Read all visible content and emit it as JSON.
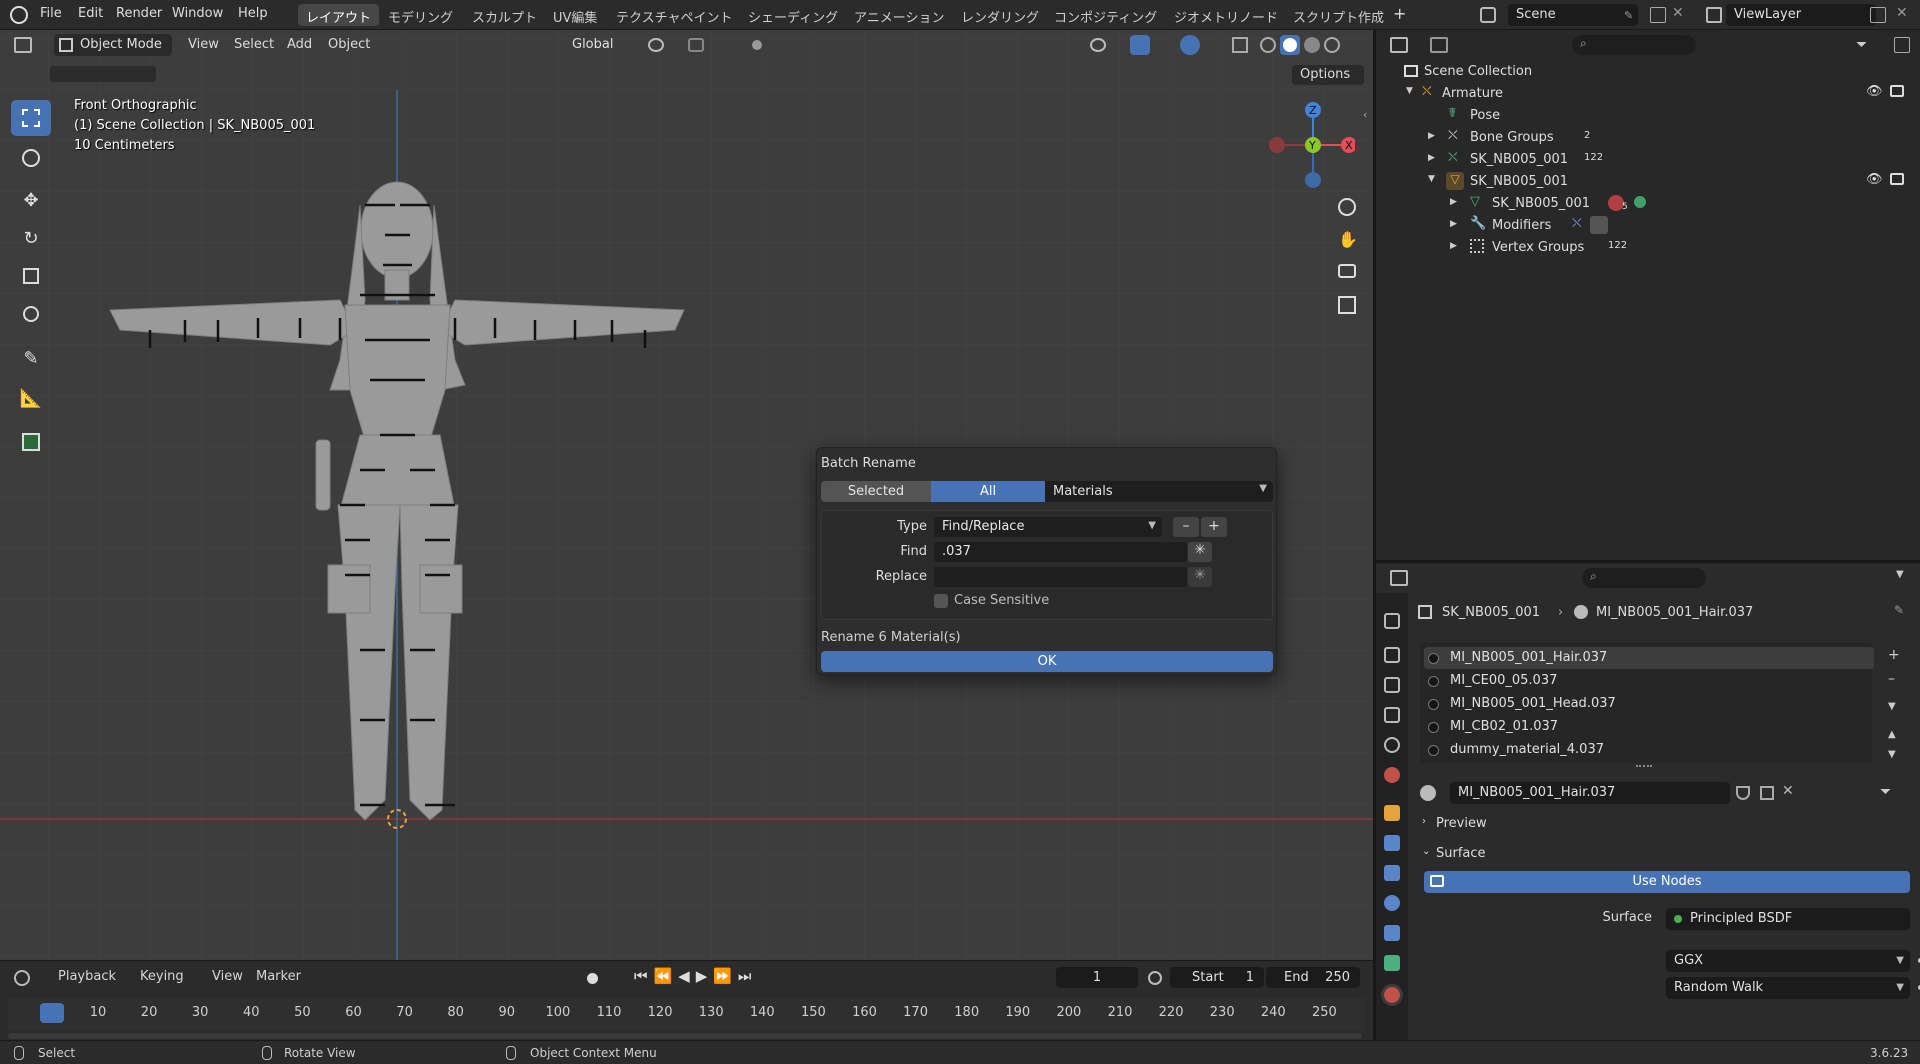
{
  "topbar": {
    "menus": [
      "File",
      "Edit",
      "Render",
      "Window",
      "Help"
    ],
    "workspaces": [
      "レイアウト",
      "モデリング",
      "スカルプト",
      "UV編集",
      "テクスチャペイント",
      "シェーディング",
      "アニメーション",
      "レンダリング",
      "コンポジティング",
      "ジオメトリノード",
      "スクリプト作成"
    ],
    "add_tab": "+",
    "scene": "Scene",
    "view_layer": "ViewLayer"
  },
  "viewport": {
    "mode": "Object Mode",
    "menus": [
      "View",
      "Select",
      "Add",
      "Object"
    ],
    "orientation": "Global",
    "options": "Options",
    "view_name": "Front Orthographic",
    "collection_info": "(1) Scene Collection | SK_NB005_001",
    "scale_info": "10 Centimeters",
    "gizmo": {
      "z": "Z",
      "y": "Y",
      "x": "X"
    }
  },
  "dialog": {
    "title": "Batch Rename",
    "tab_selected": "Selected",
    "tab_all": "All",
    "data_type": "Materials",
    "type_label": "Type",
    "type_value": "Find/Replace",
    "find_label": "Find",
    "find_value": ".037",
    "replace_label": "Replace",
    "replace_value": "",
    "case_sensitive": "Case Sensitive",
    "summary": "Rename 6 Material(s)",
    "ok": "OK"
  },
  "timeline": {
    "menus": [
      "Playback",
      "Keying",
      "View",
      "Marker"
    ],
    "current_frame": "1",
    "start_label": "Start",
    "start": "1",
    "end_label": "End",
    "end": "250",
    "ticks": [
      "1",
      "10",
      "20",
      "30",
      "40",
      "50",
      "60",
      "70",
      "80",
      "90",
      "100",
      "110",
      "120",
      "130",
      "140",
      "150",
      "160",
      "170",
      "180",
      "190",
      "200",
      "210",
      "220",
      "230",
      "240",
      "250"
    ]
  },
  "statusbar": {
    "select": "Select",
    "rotate": "Rotate View",
    "context": "Object Context Menu",
    "version": "3.6.23"
  },
  "outliner": {
    "scene_collection": "Scene Collection",
    "rows": [
      {
        "label": "Armature",
        "badge": ""
      },
      {
        "label": "Pose",
        "badge": ""
      },
      {
        "label": "Bone Groups",
        "badge": "2"
      },
      {
        "label": "SK_NB005_001",
        "badge": "122"
      },
      {
        "label": "SK_NB005_001",
        "badge": ""
      },
      {
        "label": "SK_NB005_001",
        "badge": "5"
      },
      {
        "label": "Modifiers",
        "badge": ""
      },
      {
        "label": "Vertex Groups",
        "badge": "122"
      }
    ]
  },
  "properties": {
    "breadcrumb_object": "SK_NB005_001",
    "breadcrumb_material": "MI_NB005_001_Hair.037",
    "materials": [
      "MI_NB005_001_Hair.037",
      "MI_CE00_05.037",
      "MI_NB005_001_Head.037",
      "MI_CB02_01.037",
      "dummy_material_4.037"
    ],
    "active_material": "MI_NB005_001_Hair.037",
    "preview": "Preview",
    "surface_panel": "Surface",
    "use_nodes": "Use Nodes",
    "surface_label": "Surface",
    "surface_value": "Principled BSDF",
    "distribution": "GGX",
    "subsurface": "Random Walk"
  },
  "colors": {
    "accent": "#4772b3",
    "background": "#3d3d3d",
    "x_axis": "#e34d5a",
    "y_axis": "#8ac926",
    "z_axis": "#3f84d8"
  }
}
